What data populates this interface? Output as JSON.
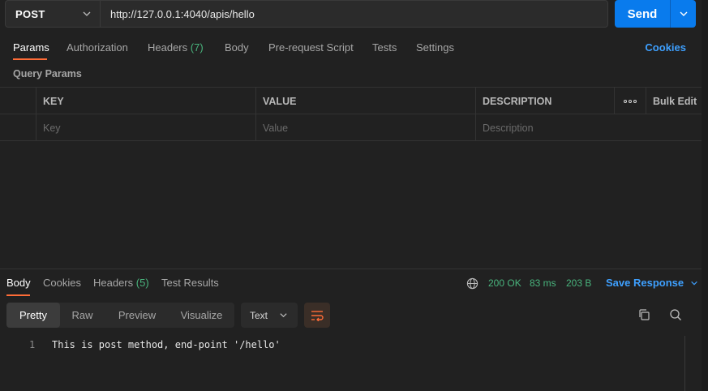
{
  "request": {
    "method": "POST",
    "url": "http://127.0.0.1:4040/apis/hello",
    "send_label": "Send"
  },
  "request_tabs": [
    {
      "label": "Params",
      "active": true
    },
    {
      "label": "Authorization"
    },
    {
      "label": "Headers",
      "count": "(7)"
    },
    {
      "label": "Body"
    },
    {
      "label": "Pre-request Script"
    },
    {
      "label": "Tests"
    },
    {
      "label": "Settings"
    }
  ],
  "cookies_label": "Cookies",
  "params": {
    "title": "Query Params",
    "headers": [
      "KEY",
      "VALUE",
      "DESCRIPTION"
    ],
    "bulk_edit": "Bulk Edit",
    "placeholders": [
      "Key",
      "Value",
      "Description"
    ]
  },
  "response": {
    "tabs": [
      {
        "label": "Body",
        "active": true
      },
      {
        "label": "Cookies"
      },
      {
        "label": "Headers",
        "count": "(5)"
      },
      {
        "label": "Test Results"
      }
    ],
    "status": "200 OK",
    "time": "83 ms",
    "size": "203 B",
    "save_label": "Save Response",
    "formats": [
      "Pretty",
      "Raw",
      "Preview",
      "Visualize"
    ],
    "active_format": "Pretty",
    "content_type": "Text",
    "lines": [
      {
        "number": "1",
        "text": "This is post method, end-point '/hello'"
      }
    ]
  },
  "colors": {
    "accent": "#ff6c37",
    "send": "#097bed",
    "link": "#3ea0ff",
    "success": "#49b47d",
    "background": "#212121"
  },
  "icons": [
    "chevron-down-icon",
    "globe-icon",
    "wrap-lines-icon",
    "copy-icon",
    "search-icon",
    "more-dots-icon"
  ]
}
